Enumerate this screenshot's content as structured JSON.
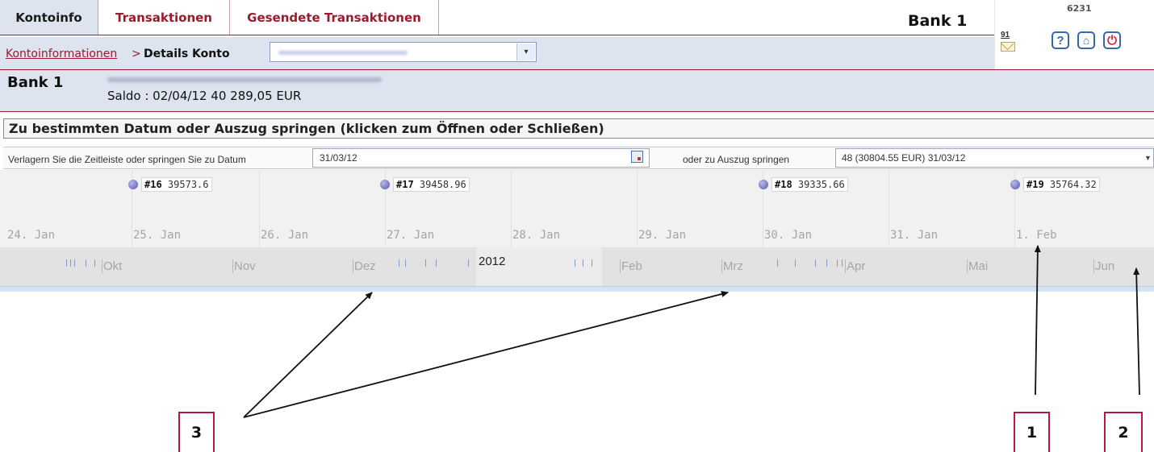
{
  "tabs": [
    {
      "label": "Kontoinfo",
      "active": true
    },
    {
      "label": "Transaktionen",
      "active": false
    },
    {
      "label": "Gesendete Transaktionen",
      "active": false
    }
  ],
  "bank_label_top": "Bank 1",
  "utility": {
    "user_id": "6231",
    "message_count": "91",
    "icons": [
      "mail-icon",
      "help-icon",
      "home-icon",
      "logout-icon"
    ],
    "help_glyph": "?",
    "home_glyph": "⌂",
    "logout_glyph": "⏻"
  },
  "breadcrumb": {
    "link": "Kontoinformationen",
    "separator": ">",
    "current": "Details Konto"
  },
  "account_select": {
    "dropdown_glyph": "▾"
  },
  "account": {
    "bank_name": "Bank 1",
    "saldo": "Saldo : 02/04/12 40 289,05 EUR"
  },
  "jump_section": {
    "title": "Zu bestimmten Datum oder Auszug springen (klicken zum Öffnen oder Schließen)",
    "shift_label": "Verlagern Sie die Zeitleiste oder springen Sie zu Datum",
    "date_value": "31/03/12",
    "statement_label": "oder zu Auszug springen",
    "statement_value": "48 (30804.55 EUR) 31/03/12"
  },
  "timeline": {
    "days": [
      "24. Jan",
      "25. Jan",
      "26. Jan",
      "27. Jan",
      "28. Jan",
      "29. Jan",
      "30. Jan",
      "31. Jan",
      "1. Feb"
    ],
    "markers": [
      {
        "num": "#16",
        "value": "39573.6"
      },
      {
        "num": "#17",
        "value": "39458.96"
      },
      {
        "num": "#18",
        "value": "39335.66"
      },
      {
        "num": "#19",
        "value": "35764.32"
      }
    ],
    "months": [
      "Okt",
      "Nov",
      "Dez",
      "Feb",
      "Mrz",
      "Apr",
      "Mai",
      "Jun"
    ],
    "year": "2012"
  },
  "callouts": [
    "3",
    "1",
    "2"
  ],
  "colors": {
    "brand_red": "#9b1b2d",
    "header_bg": "#dde3ef",
    "callout_border": "#b0184a",
    "marker_dot": "#5757a8"
  }
}
